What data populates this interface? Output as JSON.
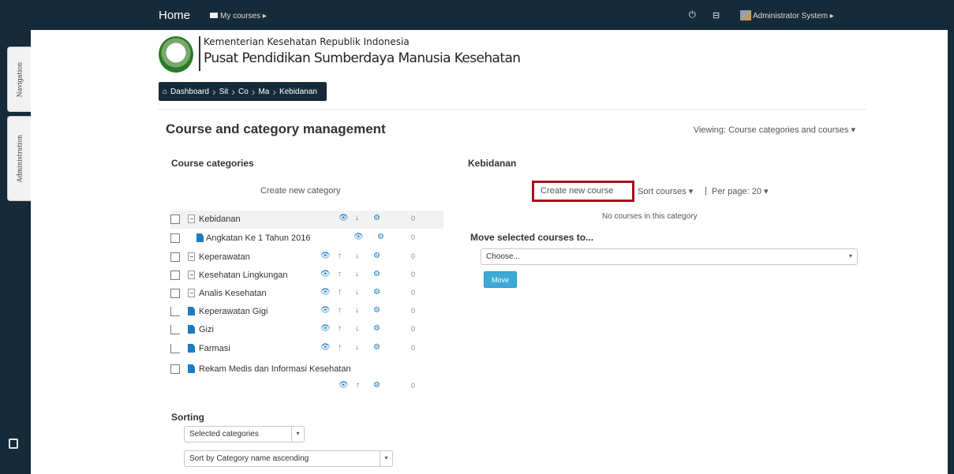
{
  "dock": {
    "nav_label": "Navigation",
    "admin_label": "Administration"
  },
  "navbar": {
    "brand": "Home",
    "my_courses": "My courses ▸",
    "power_icon": "⏻",
    "msg_icon": "⊟",
    "user": "Administrator System ▸"
  },
  "header": {
    "org_line1": "Kementerian Kesehatan Republik Indonesia",
    "org_line2": "Pusat Pendidikan Sumberdaya Manusia Kesehatan"
  },
  "breadcrumb": {
    "items": [
      "Dashboard",
      "Sit",
      "Co",
      "Ma",
      "Kebidanan"
    ]
  },
  "page": {
    "title": "Course and category management",
    "viewing_label": "Viewing:",
    "viewing_value": "Course categories and courses ▾"
  },
  "categories": {
    "heading": "Course categories",
    "create_label": "Create new category",
    "rows": [
      {
        "name": "Kebidanan",
        "count": "0"
      },
      {
        "name": "Angkatan Ke 1 Tahun 2016",
        "count": "0"
      },
      {
        "name": "Keperawatan",
        "count": "0"
      },
      {
        "name": "Kesehatan Lingkungan",
        "count": "0"
      },
      {
        "name": "Analis Kesehatan",
        "count": "0"
      },
      {
        "name": "Keperawatan Gigi",
        "count": "0"
      },
      {
        "name": "Gizi",
        "count": "0"
      },
      {
        "name": "Farmasi",
        "count": "0"
      },
      {
        "name": "Rekam Medis dan Informasi Kesehatan",
        "count": "0"
      }
    ]
  },
  "sorting": {
    "heading": "Sorting",
    "scope_value": "Selected categories",
    "order_value": "Sort by Category name ascending"
  },
  "courses": {
    "heading": "Kebidanan",
    "create_label": "Create new course",
    "sort_label": "Sort courses ▾",
    "separator": "|",
    "per_page_label": "Per page: 20 ▾",
    "empty_text": "No courses in this category",
    "move_heading": "Move selected courses to...",
    "move_select_value": "Choose...",
    "move_button": "Move"
  },
  "colors": {
    "navbar": "#152b3a",
    "link": "#1c7cc0",
    "highlight_box": "#a40f1a",
    "move_button": "#3caad6"
  }
}
